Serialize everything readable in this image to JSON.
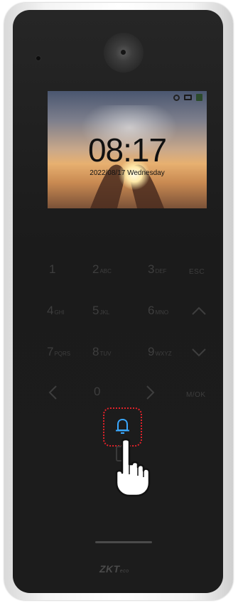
{
  "screen": {
    "time": "08:17",
    "date": "2022/08/17 Wednesday",
    "status_icons": [
      "gear-icon",
      "monitor-icon",
      "card-icon"
    ]
  },
  "keypad": {
    "k1": {
      "digit": "1",
      "letters": ""
    },
    "k2": {
      "digit": "2",
      "letters": "ABC"
    },
    "k3": {
      "digit": "3",
      "letters": "DEF"
    },
    "esc": "ESC",
    "k4": {
      "digit": "4",
      "letters": "GHI"
    },
    "k5": {
      "digit": "5",
      "letters": "JKL"
    },
    "k6": {
      "digit": "6",
      "letters": "MNO"
    },
    "up": "chevron-up-icon",
    "k7": {
      "digit": "7",
      "letters": "PQRS"
    },
    "k8": {
      "digit": "8",
      "letters": "TUV"
    },
    "k9": {
      "digit": "9",
      "letters": "WXYZ"
    },
    "down": "chevron-down-icon",
    "left": "chevron-left-icon",
    "k0": {
      "digit": "0",
      "letters": ""
    },
    "right": "chevron-right-icon",
    "mok": "M/OK"
  },
  "doorbell": {
    "icon": "bell-icon",
    "highlight_color": "#e0222a",
    "icon_color": "#3aa8ff"
  },
  "brand": {
    "name": "ZKT",
    "suffix": "eco"
  }
}
